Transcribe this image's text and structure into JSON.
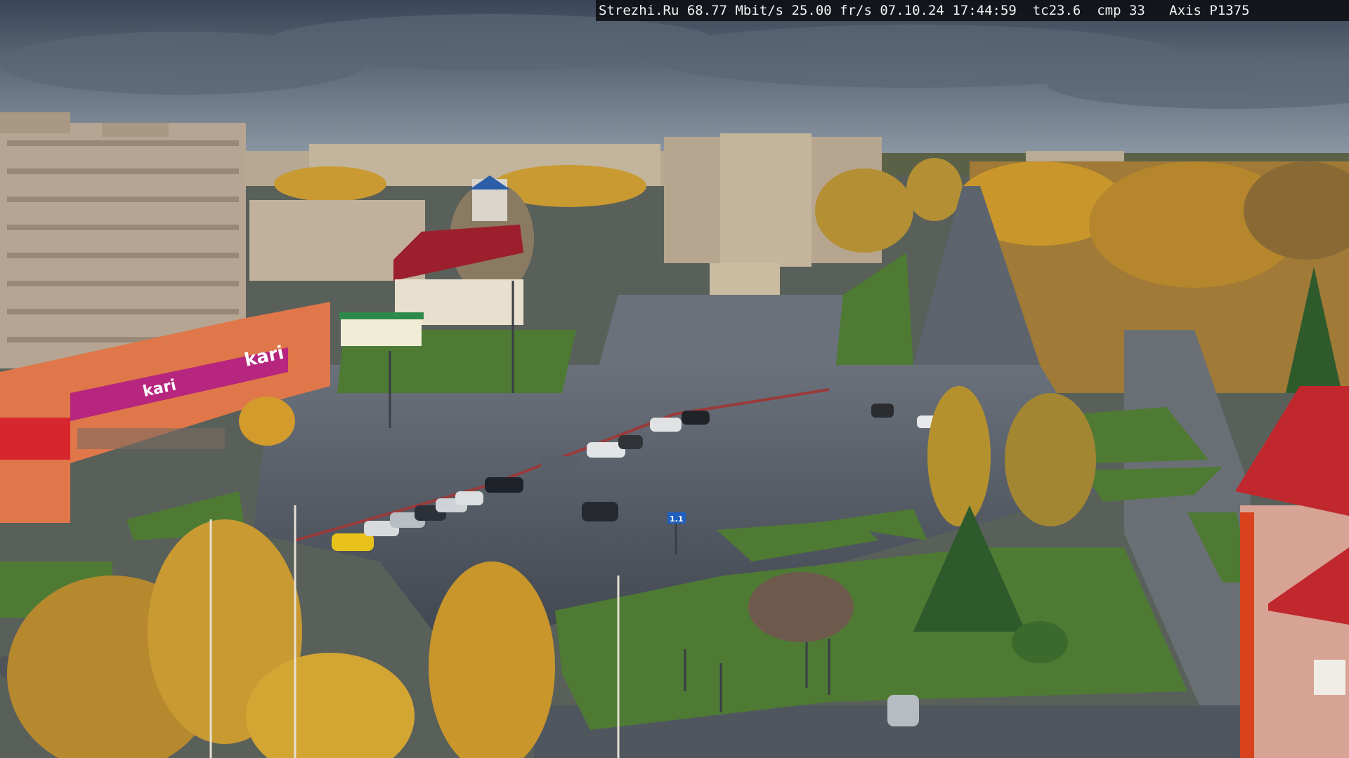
{
  "osd": {
    "text": "Strezhi.Ru 68.77 Mbit/s 25.00 fr/s 07.10.24 17:44:59  tc23.6  cmp 33   Axis P1375"
  },
  "signs": {
    "store_brand": "kari",
    "store_brand_small": "kari",
    "road_sign_number": "1.1"
  },
  "colors": {
    "sky_top": "#3e4a5a",
    "sky_bottom": "#8894a0",
    "asphalt": "#4f5660",
    "grass": "#4e7a34",
    "autumn_yellow": "#c9962c",
    "brick_red": "#c0282e",
    "store_orange": "#e2774a",
    "store_magenta": "#b6257e"
  }
}
